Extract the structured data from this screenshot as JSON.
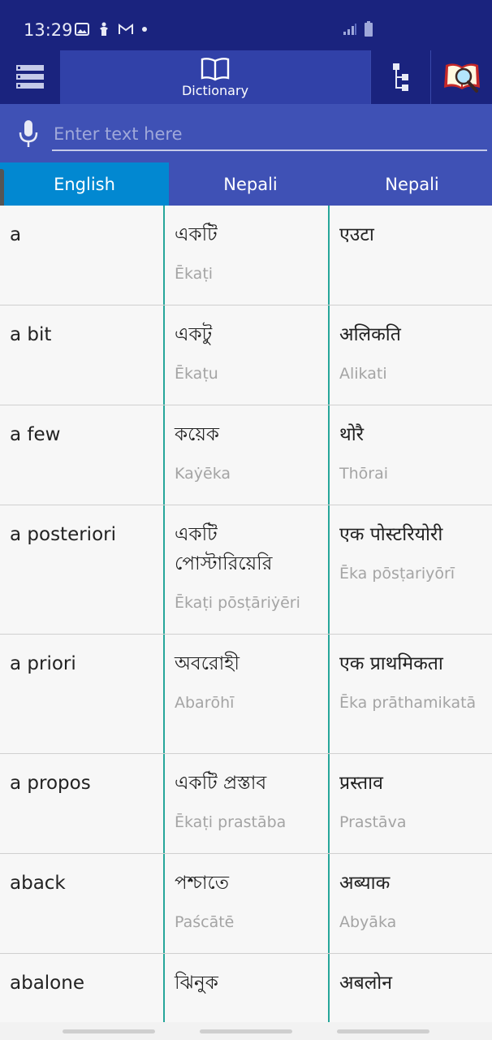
{
  "status": {
    "time": "13:29"
  },
  "toolbar": {
    "dictionary_label": "Dictionary"
  },
  "search": {
    "placeholder": "Enter text here"
  },
  "tabs": [
    "English",
    "Nepali",
    "Nepali"
  ],
  "rows": [
    {
      "en": "a",
      "bn": "একটি",
      "bn_roman": "Ēkaṭi",
      "ne": "एउटा",
      "ne_roman": ""
    },
    {
      "en": "a bit",
      "bn": "একটু",
      "bn_roman": "Ēkaṭu",
      "ne": "अलिकति",
      "ne_roman": "Alikati"
    },
    {
      "en": "a few",
      "bn": "কয়েক",
      "bn_roman": "Kaẏēka",
      "ne": "थोरै",
      "ne_roman": "Thōrai"
    },
    {
      "en": "a posteriori",
      "bn": "একটি পোস্টারিয়েরি",
      "bn_roman": "Ēkaṭi pōsṭāriẏēri",
      "ne": "एक पोस्टरियोरी",
      "ne_roman": "Ēka pōsṭariyōrī"
    },
    {
      "en": "a priori",
      "bn": "অবরোহী",
      "bn_roman": "Abarōhī",
      "ne": "एक प्राथमिकता",
      "ne_roman": "Ēka prāthamikatā"
    },
    {
      "en": "a propos",
      "bn": "একটি প্রস্তাব",
      "bn_roman": "Ēkaṭi prastāba",
      "ne": "प्रस्ताव",
      "ne_roman": "Prastāva"
    },
    {
      "en": "aback",
      "bn": "পশ্চাতে",
      "bn_roman": "Paścātē",
      "ne": "अब्याक",
      "ne_roman": "Abyāka"
    },
    {
      "en": "abalone",
      "bn": "ঝিনুক",
      "bn_roman": "",
      "ne": "अबलोन",
      "ne_roman": ""
    }
  ]
}
